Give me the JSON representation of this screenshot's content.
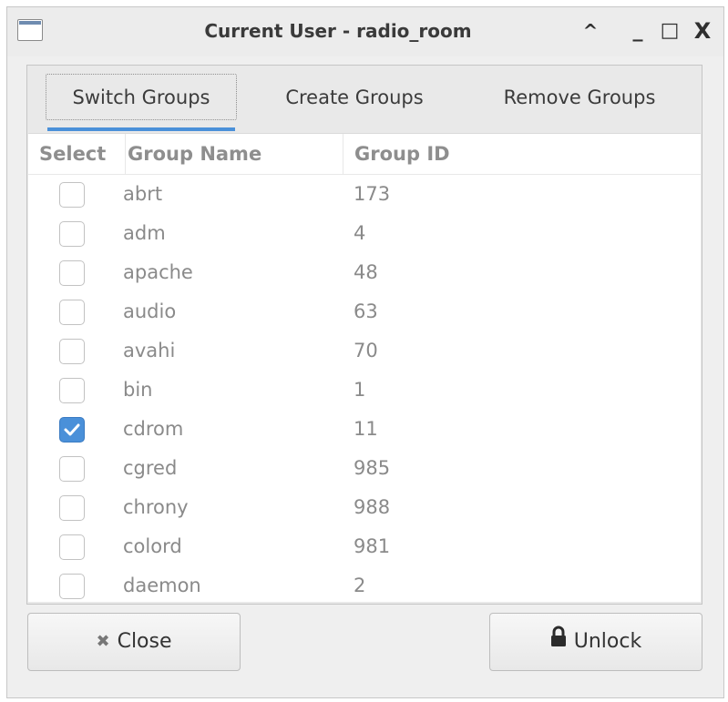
{
  "window": {
    "title": "Current User - radio_room",
    "controls": {
      "shade": "^",
      "minimize": "_",
      "maximize": "□",
      "close": "X"
    }
  },
  "tabs": [
    {
      "label": "Switch Groups",
      "active": true
    },
    {
      "label": "Create Groups",
      "active": false
    },
    {
      "label": "Remove Groups",
      "active": false
    }
  ],
  "table": {
    "columns": [
      "Select",
      "Group Name",
      "Group ID"
    ],
    "rows": [
      {
        "name": "abrt",
        "gid": "173",
        "checked": false
      },
      {
        "name": "adm",
        "gid": "4",
        "checked": false
      },
      {
        "name": "apache",
        "gid": "48",
        "checked": false
      },
      {
        "name": "audio",
        "gid": "63",
        "checked": false
      },
      {
        "name": "avahi",
        "gid": "70",
        "checked": false
      },
      {
        "name": "bin",
        "gid": "1",
        "checked": false
      },
      {
        "name": "cdrom",
        "gid": "11",
        "checked": true
      },
      {
        "name": "cgred",
        "gid": "985",
        "checked": false
      },
      {
        "name": "chrony",
        "gid": "988",
        "checked": false
      },
      {
        "name": "colord",
        "gid": "981",
        "checked": false
      },
      {
        "name": "daemon",
        "gid": "2",
        "checked": false
      }
    ]
  },
  "buttons": {
    "close": {
      "label": "Close",
      "icon": "close-x-icon"
    },
    "unlock": {
      "label": "Unlock",
      "icon": "lock-icon"
    }
  },
  "colors": {
    "accent": "#4a90d9"
  }
}
